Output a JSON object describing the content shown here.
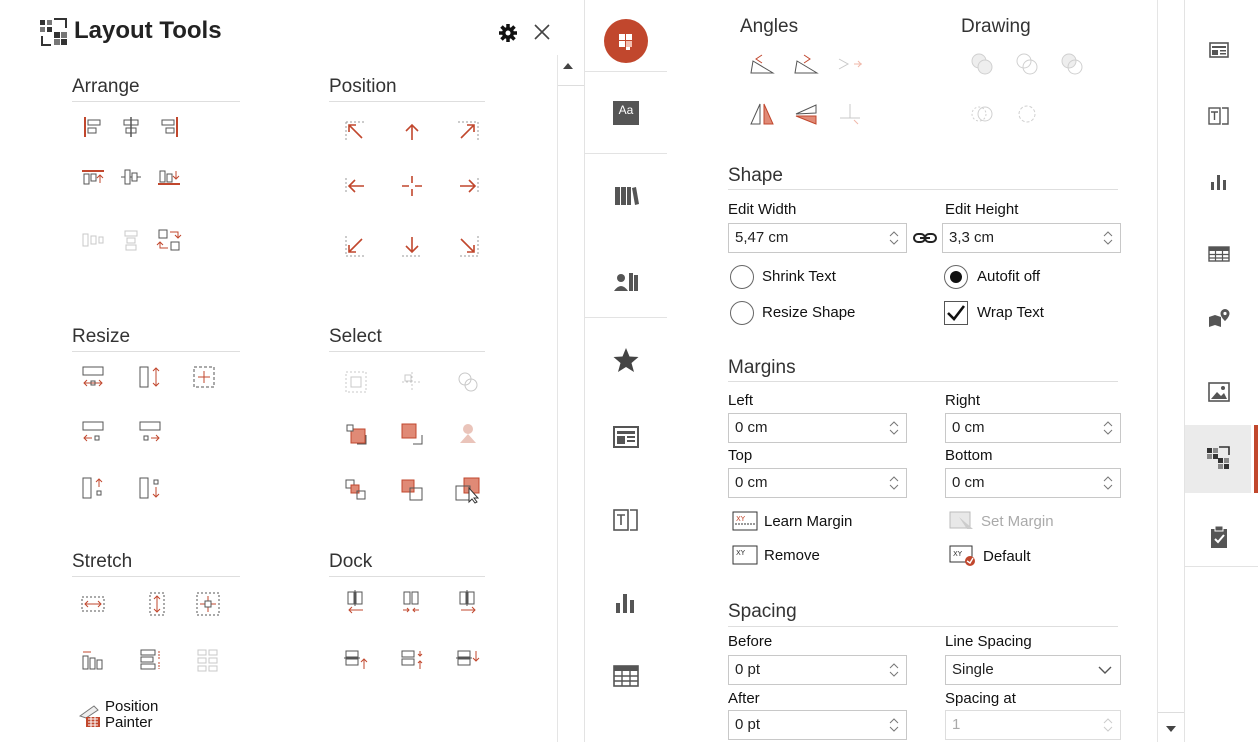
{
  "left_panel": {
    "title": "Layout Tools",
    "sections": {
      "arrange": "Arrange",
      "position": "Position",
      "resize": "Resize",
      "select": "Select",
      "stretch": "Stretch",
      "dock": "Dock"
    },
    "position_painter": [
      "Position",
      "Painter"
    ]
  },
  "right_panel": {
    "angles": "Angles",
    "drawing": "Drawing",
    "shape": {
      "title": "Shape",
      "edit_width_label": "Edit Width",
      "edit_width_value": "5,47 cm",
      "edit_height_label": "Edit Height",
      "edit_height_value": "3,3 cm",
      "shrink_text": "Shrink Text",
      "autofit_off": "Autofit off",
      "resize_shape": "Resize Shape",
      "wrap_text": "Wrap Text"
    },
    "margins": {
      "title": "Margins",
      "left_label": "Left",
      "left_value": "0 cm",
      "right_label": "Right",
      "right_value": "0 cm",
      "top_label": "Top",
      "top_value": "0 cm",
      "bottom_label": "Bottom",
      "bottom_value": "0 cm",
      "learn_margin": "Learn Margin",
      "set_margin": "Set Margin",
      "remove": "Remove",
      "default": "Default"
    },
    "spacing": {
      "title": "Spacing",
      "before_label": "Before",
      "before_value": "0 pt",
      "line_spacing_label": "Line Spacing",
      "line_spacing_value": "Single",
      "after_label": "After",
      "after_value": "0 pt",
      "spacing_at_label": "Spacing at",
      "spacing_at_value": "1"
    }
  },
  "colors": {
    "accent": "#c1472d",
    "icon_gray": "#555555",
    "disabled": "#c8c8c8"
  }
}
